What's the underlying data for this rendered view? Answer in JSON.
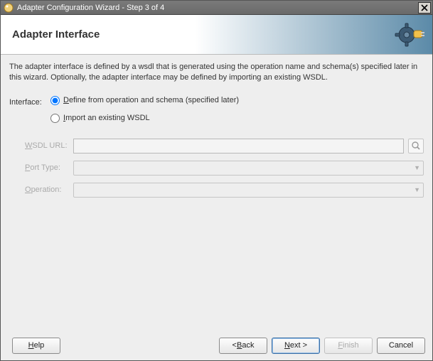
{
  "window": {
    "title": "Adapter Configuration Wizard - Step 3 of 4"
  },
  "banner": {
    "title": "Adapter Interface"
  },
  "description": "The adapter interface is defined by a wsdl that is generated using the operation name and schema(s) specified later in this wizard.  Optionally, the adapter interface may be defined by importing an existing WSDL.",
  "form": {
    "interface_label": "Interface:",
    "radio_define_prefix": "D",
    "radio_define_rest": "efine from operation and schema (specified later)",
    "radio_import_prefix": "I",
    "radio_import_rest": "mport an existing WSDL",
    "selected": "define",
    "wsdl_label_prefix": "W",
    "wsdl_label_rest": "SDL URL:",
    "wsdl_value": "",
    "port_label_prefix": "P",
    "port_label_rest": "ort Type:",
    "port_value": "",
    "operation_label_prefix": "O",
    "operation_label_rest": "peration:",
    "operation_value": ""
  },
  "buttons": {
    "help": "Help",
    "back": "< Back",
    "back_prefix": "< ",
    "back_ul": "B",
    "back_rest": "ack",
    "next_ul": "N",
    "next_rest": "ext >",
    "finish_ul": "F",
    "finish_rest": "inish",
    "cancel": "Cancel"
  }
}
